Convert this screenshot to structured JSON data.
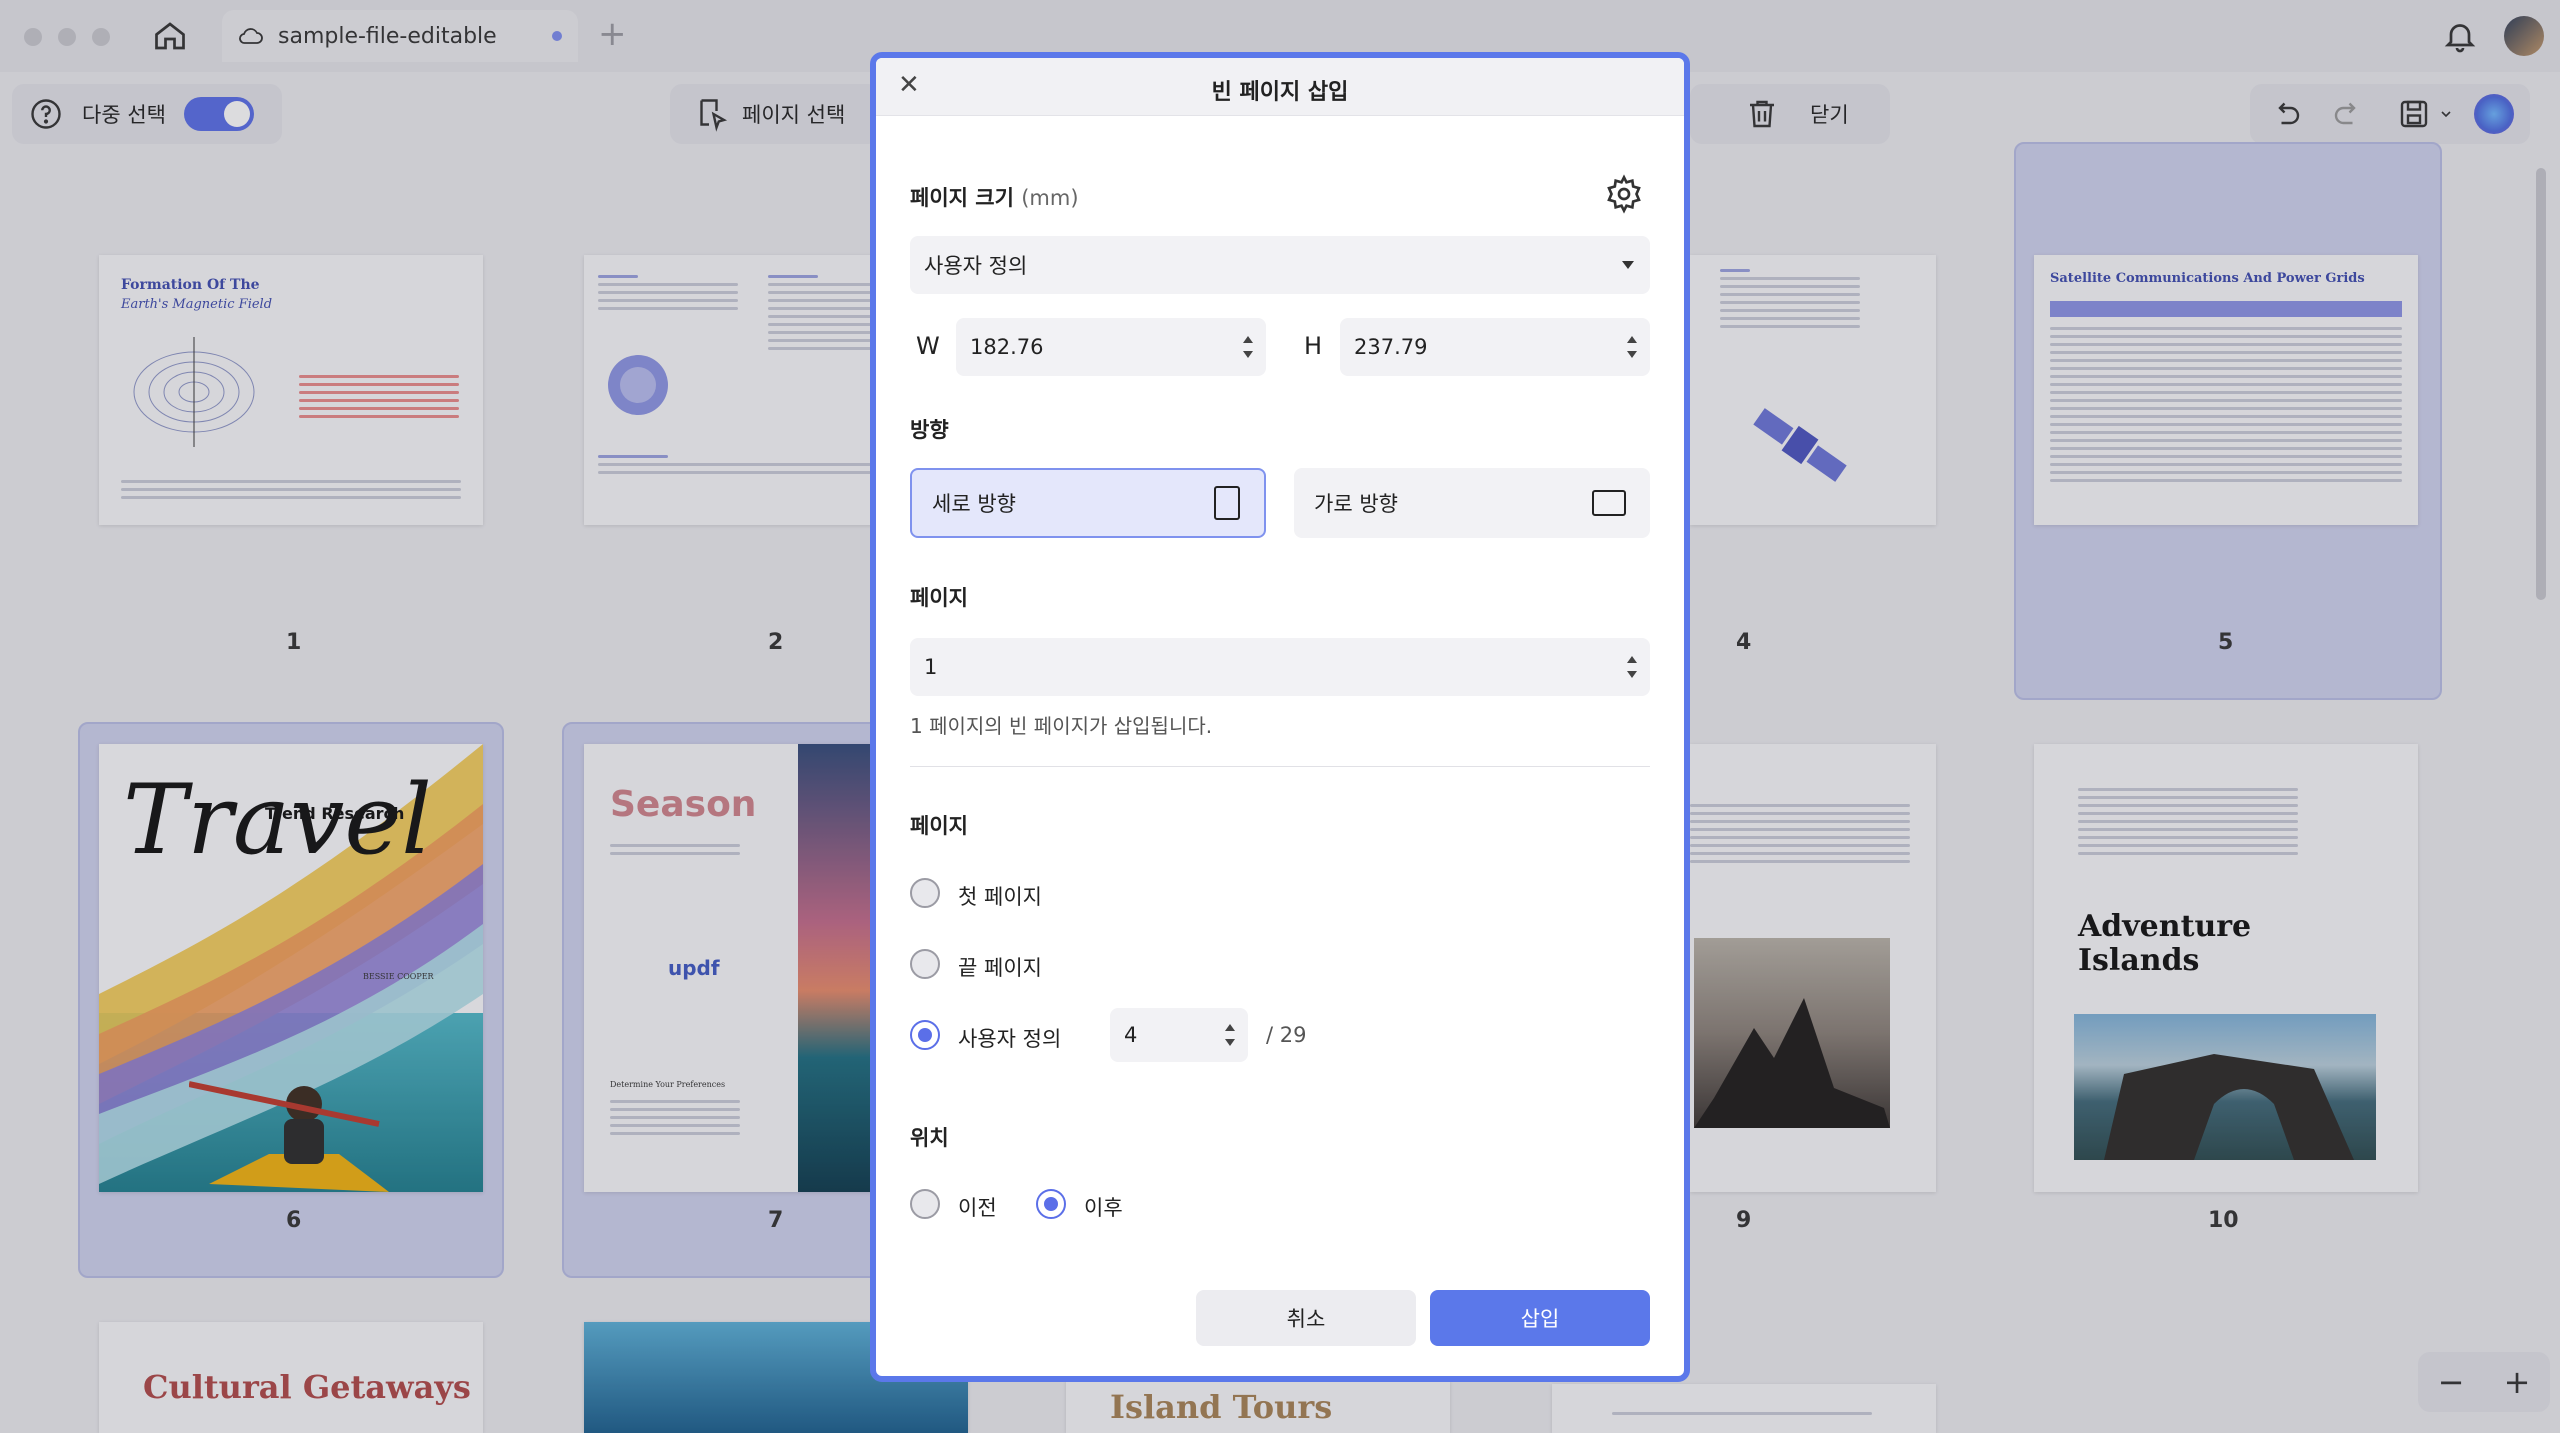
{
  "tab": {
    "title": "sample-file-editable"
  },
  "toolbar": {
    "multi_select_label": "다중 선택",
    "page_select_label": "페이지 선택",
    "close_label": "닫기"
  },
  "pages": [
    {
      "num": "1",
      "title_line1": "Formation Of The",
      "title_line2": "Earth's Magnetic Field"
    },
    {
      "num": "2"
    },
    {
      "num": "4"
    },
    {
      "num": "5",
      "title": "Satellite Communications And Power Grids"
    },
    {
      "num": "6",
      "title": "Travel",
      "subtitle": "Trend Research",
      "author": "BESSIE COOPER"
    },
    {
      "num": "7",
      "title": "Season",
      "brand": "updf",
      "section": "Determine Your Preferences"
    },
    {
      "num": "9"
    },
    {
      "num": "10",
      "title": "Adventure Islands"
    }
  ],
  "bottom_pages": {
    "cultural": "Cultural Getaways",
    "island": "Island Tours"
  },
  "dialog": {
    "title": "빈 페이지 삽입",
    "page_size_label": "페이지 크기",
    "page_size_unit": "(mm)",
    "size_preset": "사용자 정의",
    "w_label": "W",
    "w_value": "182.76",
    "h_label": "H",
    "h_value": "237.79",
    "orientation_label": "방향",
    "portrait_label": "세로 방향",
    "landscape_label": "가로 방향",
    "page_count_label": "페이지",
    "page_count_value": "1",
    "hint": "1 페이지의 빈 페이지가 삽입됩니다.",
    "page_target_label": "페이지",
    "first_page": "첫 페이지",
    "last_page": "끝 페이지",
    "custom_page": "사용자 정의",
    "custom_page_value": "4",
    "total_pages": "/ 29",
    "position_label": "위치",
    "before": "이전",
    "after": "이후",
    "cancel": "취소",
    "insert": "삽입"
  },
  "zoom": {
    "minus": "−",
    "plus": "+"
  }
}
